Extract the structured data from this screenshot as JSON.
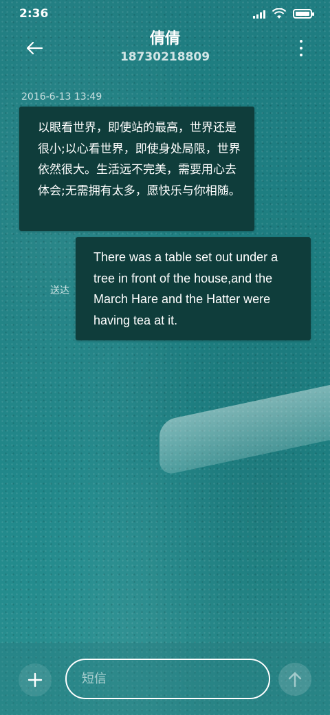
{
  "status_bar": {
    "time": "2:36",
    "battery_level": 1.0,
    "icons": [
      "signal-icon",
      "wifi-icon",
      "battery-icon"
    ]
  },
  "header": {
    "contact_name": "倩倩",
    "phone_number": "18730218809",
    "icons": [
      "back-arrow-icon",
      "more-vert-icon"
    ]
  },
  "conversation": {
    "timestamp": "2016-6-13 13:49",
    "received_message": "以眼看世界，即使站的最高，世界还是很小;以心看世界，即使身处局限，世界依然很大。生活远不完美，需要用心去体会;无需拥有太多，愿快乐与你相随。",
    "sent_message": "There was a table set out under a tree in front of the house,and the March Hare and the Hatter were having tea at it.",
    "sent_status": "送达"
  },
  "composer": {
    "placeholder": "短信",
    "value": "",
    "icons": [
      "plus-icon",
      "send-arrow-icon"
    ]
  },
  "colors": {
    "background": "#1f7d81",
    "bubble": "#0f3d3b",
    "text": "#ffffff"
  }
}
